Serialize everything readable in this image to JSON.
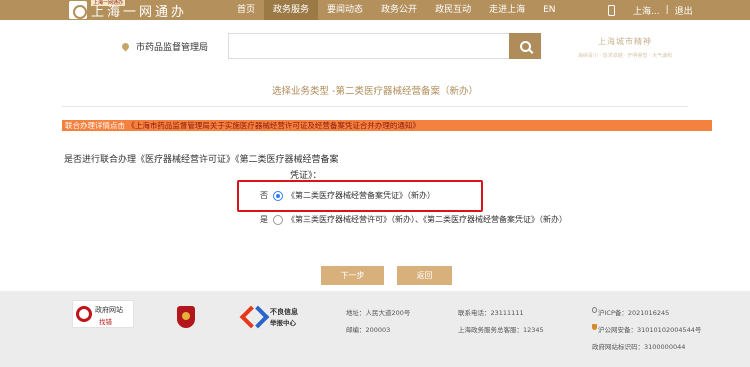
{
  "header": {
    "logo_subtitle": "上海一网通办",
    "logo_title": "上海一网通办",
    "nav": [
      "首页",
      "政务服务",
      "要闻动态",
      "政务公开",
      "政民互动",
      "走进上海",
      "EN"
    ],
    "nav_active_index": 1,
    "user_name": "上海...",
    "logout_label": "退出",
    "separator": "|"
  },
  "search": {
    "location_label": "市药品监督管理局",
    "placeholder": "",
    "slogan_title": "上海城市精神",
    "slogan_sub": "海纳百川 · 追求卓越 · 开明睿智 · 大气谦和"
  },
  "page": {
    "title": "选择业务类型 -第二类医疗器械经营备案（新办）",
    "notice_label": "联合办理详情点击",
    "notice_link": "《上海市药品监督管理局关于实施医疗器械经营许可证及经营备案凭证合并办理的通知》",
    "question_line1": "是否进行联合办理《医疗器械经营许可证》《第二类医疗器械经营备案",
    "question_line2": "凭证》："
  },
  "options": [
    {
      "key": "否",
      "label": "《第二类医疗器械经营备案凭证》（新办）",
      "checked": true
    },
    {
      "key": "是",
      "label": "《第三类医疗器械经营许可》（新办）、《第二类医疗器械经营备案凭证》（新办）",
      "checked": false
    }
  ],
  "buttons": {
    "next": "下一步",
    "back": "返回"
  },
  "footer": {
    "badge_title": "政府网站",
    "badge_sub": "找错",
    "report_title": "不良信息",
    "report_sub": "举报中心",
    "address": "地址：人民大道200号",
    "postcode": "邮编：200003",
    "tel": "联系电话：23111111",
    "hotline": "上海政务服务总客服：12345",
    "icp": "沪ICP备：2021016245",
    "police": "沪公网安备：31010102004544号",
    "site_code": "政府网站标识码：3100000044"
  },
  "colors": {
    "brand": "#b4905c",
    "nav_active": "#9c7a45",
    "notice_bg": "#f4813e",
    "highlight": "#d8141a",
    "button": "#d8b07b",
    "radio": "#2e7cf6"
  }
}
